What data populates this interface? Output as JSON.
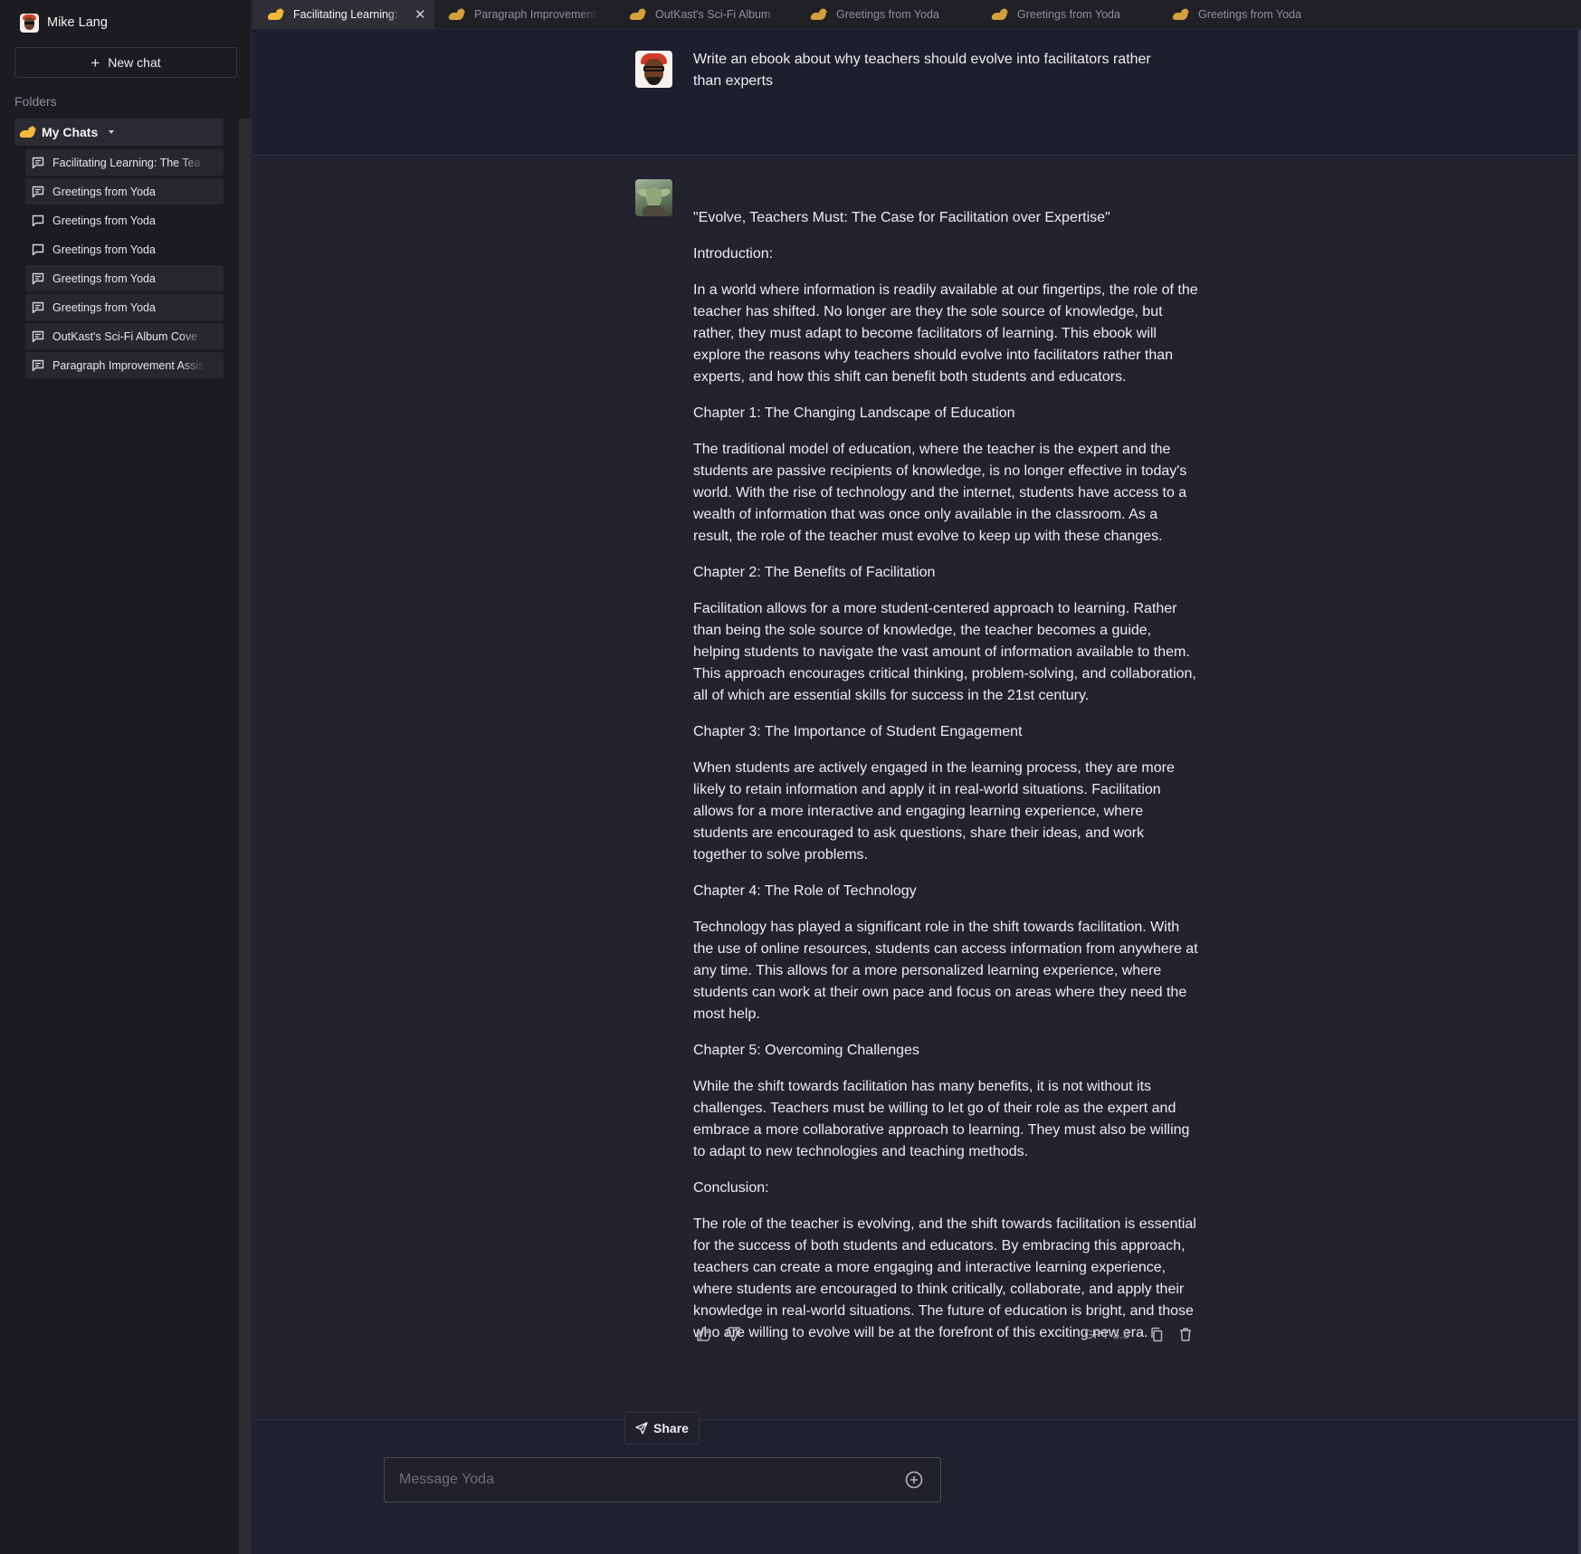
{
  "sidebar": {
    "user_name": "Mike Lang",
    "new_chat_label": "New chat",
    "folders_label": "Folders",
    "folder_name": "My Chats",
    "chats": [
      {
        "label": "Facilitating Learning: The Tea",
        "icon": "chat-bubble-filled-icon"
      },
      {
        "label": "Greetings from Yoda",
        "icon": "chat-bubble-filled-icon"
      },
      {
        "label": "Greetings from Yoda",
        "icon": "chat-bubble-outline-icon"
      },
      {
        "label": "Greetings from Yoda",
        "icon": "chat-bubble-outline-icon"
      },
      {
        "label": "Greetings from Yoda",
        "icon": "chat-bubble-filled-icon"
      },
      {
        "label": "Greetings from Yoda",
        "icon": "chat-bubble-filled-icon"
      },
      {
        "label": "OutKast's Sci-Fi Album Cove",
        "icon": "chat-bubble-filled-icon"
      },
      {
        "label": "Paragraph Improvement Assis",
        "icon": "chat-bubble-filled-icon"
      }
    ]
  },
  "tabs": [
    {
      "label": "Facilitating Learning:",
      "active": true
    },
    {
      "label": "Paragraph Improvement",
      "active": false
    },
    {
      "label": "OutKast's Sci-Fi Album",
      "active": false
    },
    {
      "label": "Greetings from Yoda",
      "active": false
    },
    {
      "label": "Greetings from Yoda",
      "active": false
    },
    {
      "label": "Greetings from Yoda",
      "active": false
    }
  ],
  "conversation": {
    "user_message": "Write an ebook about why teachers should evolve into facilitators rather than experts",
    "assistant_paragraphs": [
      "\"Evolve, Teachers Must: The Case for Facilitation over Expertise\"",
      "Introduction:",
      "In a world where information is readily available at our fingertips, the role of the teacher has shifted. No longer are they the sole source of knowledge, but rather, they must adapt to become facilitators of learning. This ebook will explore the reasons why teachers should evolve into facilitators rather than experts, and how this shift can benefit both students and educators.",
      "Chapter 1: The Changing Landscape of Education",
      "The traditional model of education, where the teacher is the expert and the students are passive recipients of knowledge, is no longer effective in today's world. With the rise of technology and the internet, students have access to a wealth of information that was once only available in the classroom. As a result, the role of the teacher must evolve to keep up with these changes.",
      "Chapter 2: The Benefits of Facilitation",
      "Facilitation allows for a more student-centered approach to learning. Rather than being the sole source of knowledge, the teacher becomes a guide, helping students to navigate the vast amount of information available to them. This approach encourages critical thinking, problem-solving, and collaboration, all of which are essential skills for success in the 21st century.",
      "Chapter 3: The Importance of Student Engagement",
      "When students are actively engaged in the learning process, they are more likely to retain information and apply it in real-world situations. Facilitation allows for a more interactive and engaging learning experience, where students are encouraged to ask questions, share their ideas, and work together to solve problems.",
      "Chapter 4: The Role of Technology",
      "Technology has played a significant role in the shift towards facilitation. With the use of online resources, students can access information from anywhere at any time. This allows for a more personalized learning experience, where students can work at their own pace and focus on areas where they need the most help.",
      "Chapter 5: Overcoming Challenges",
      "While the shift towards facilitation has many benefits, it is not without its challenges. Teachers must be willing to let go of their role as the expert and embrace a more collaborative approach to learning. They must also be willing to adapt to new technologies and teaching methods.",
      "Conclusion:",
      "The role of the teacher is evolving, and the shift towards facilitation is essential for the success of both students and educators. By embracing this approach, teachers can create a more engaging and interactive learning experience, where students are encouraged to think critically, collaborate, and apply their knowledge in real-world situations. The future of education is bright, and those who are willing to evolve will be at the forefront of this exciting new era."
    ],
    "model_label": "GPT-3.5"
  },
  "share_label": "Share",
  "composer": {
    "placeholder": "Message Yoda"
  },
  "colors": {
    "background": "#1f2130",
    "sidebar": "#1c1c20",
    "accent_hand": "#f6b73c"
  }
}
